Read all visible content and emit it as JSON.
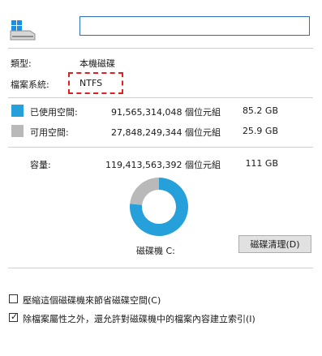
{
  "header": {
    "name_value": ""
  },
  "info": {
    "type_label": "類型:",
    "type_value": "本機磁碟",
    "fs_label": "檔案系統:",
    "fs_value": "NTFS"
  },
  "usage": {
    "used": {
      "label": "已使用空間:",
      "bytes": "91,565,314,048 個位元組",
      "size": "85.2 GB",
      "color": "#26a0da"
    },
    "free": {
      "label": "可用空間:",
      "bytes": "27,848,249,344 個位元組",
      "size": "25.9 GB",
      "color": "#b9b9b9"
    },
    "capacity": {
      "label": "容量:",
      "bytes": "119,413,563,392 個位元組",
      "size": "111 GB"
    }
  },
  "chart_data": {
    "type": "pie",
    "categories": [
      "已使用空間",
      "可用空間"
    ],
    "values": [
      85.2,
      25.9
    ],
    "colors": [
      "#26a0da",
      "#b9b9b9"
    ]
  },
  "drive": {
    "label": "磁碟機 C:",
    "cleanup_button": "磁碟清理(D)"
  },
  "options": {
    "compress": {
      "label": "壓縮這個磁碟機來節省磁碟空間(C)",
      "checked": false
    },
    "index": {
      "label": "除檔案屬性之外，還允許對磁碟機中的檔案內容建立索引(I)",
      "checked": true,
      "mark": "✓"
    }
  }
}
